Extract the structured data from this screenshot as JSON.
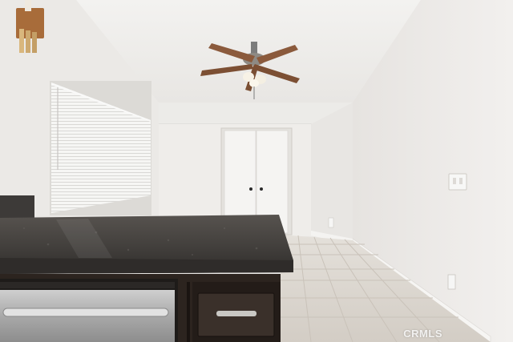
{
  "photo": {
    "subject": "kitchen-dining-room",
    "watermark": "CRMLS",
    "colors": {
      "wall": "#eeeceb",
      "ceiling": "#f1f0ee",
      "countertop": "#4a4745",
      "cabinet": "#2c241f",
      "tile": "#dcd7d0",
      "fan_blade": "#8b5a3c"
    }
  }
}
